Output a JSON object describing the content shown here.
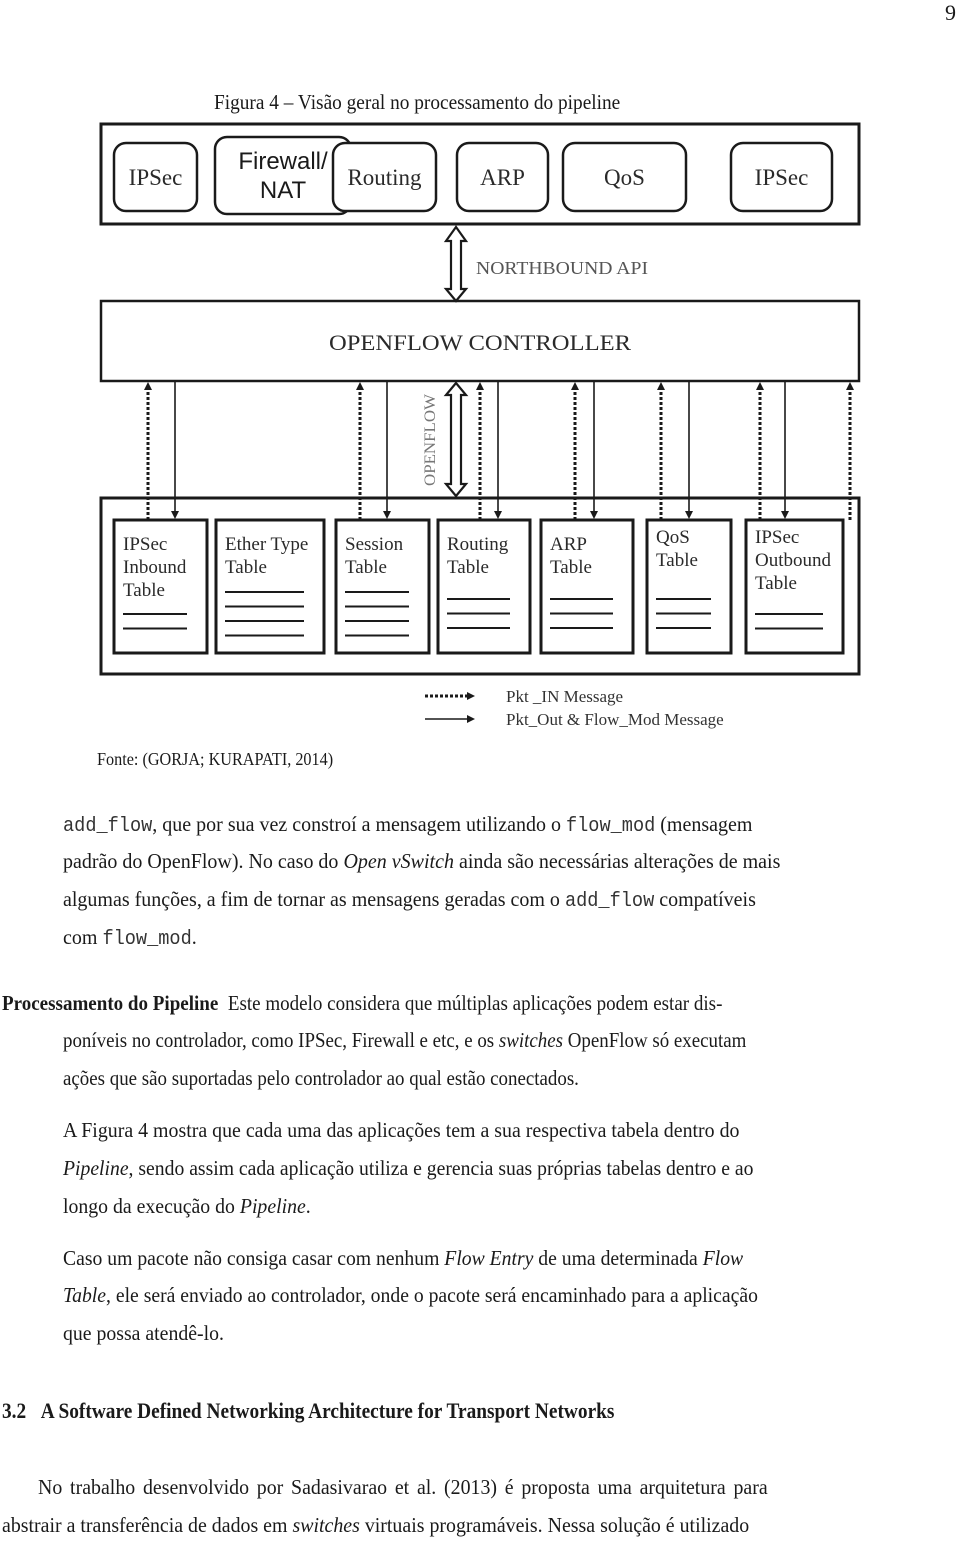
{
  "page": {
    "number": "9"
  },
  "figure": {
    "caption": "Figura 4 – Visão geral no processamento do pipeline",
    "source": "Fonte: (GORJA; KURAPATI, 2014)",
    "applications": [
      "IPSec",
      "Firewall/\nNAT",
      "Routing",
      "ARP",
      "QoS",
      "IPSec"
    ],
    "northbound_label": "NORTHBOUND API",
    "controller_label": "OPENFLOW CONTROLLER",
    "openflow_label": "OPENFLOW",
    "tables": [
      {
        "lines": [
          "IPSec",
          "Inbound",
          "Table"
        ],
        "entries": 2
      },
      {
        "lines": [
          "Ether Type",
          "Table"
        ],
        "entries": 4
      },
      {
        "lines": [
          "Session",
          "Table"
        ],
        "entries": 4
      },
      {
        "lines": [
          "Routing",
          "Table"
        ],
        "entries": 3
      },
      {
        "lines": [
          "ARP",
          "Table"
        ],
        "entries": 3
      },
      {
        "lines": [
          "QoS",
          "Table"
        ],
        "entries": 3
      },
      {
        "lines": [
          "IPSec",
          "Outbound",
          "Table"
        ],
        "entries": 2
      }
    ],
    "legend": [
      {
        "style": "dotted",
        "label": "Pkt _IN Message"
      },
      {
        "style": "solid",
        "label": "Pkt_Out & Flow_Mod Message"
      }
    ]
  },
  "body": {
    "p1": {
      "l1": {
        "c1": "add_flow",
        "t1": ", que por sua vez constroí a mensagem utilizando o ",
        "c2": "flow_mod",
        "t2": " (mensagem"
      },
      "l2": {
        "t1": "padrão do OpenFlow). No caso do ",
        "i1": "Open vSwitch",
        "t2": " ainda são necessárias alterações de mais"
      },
      "l3": {
        "t1": "algumas funções, a fim de tornar as mensagens geradas com o ",
        "c1": "add_flow",
        "t2": " compatíveis"
      },
      "l4": {
        "t1": "com ",
        "c1": "flow_mod",
        "t2": "."
      }
    },
    "p2": {
      "heading": "Processamento do Pipeline",
      "l1": "Este modelo considera que múltiplas aplicações podem estar dis-",
      "l2": {
        "t1": "poníveis no controlador, como IPSec, Firewall e etc, e os ",
        "i1": "switches",
        "t2": " OpenFlow só executam"
      },
      "l3": "ações que são suportadas pelo controlador ao qual estão conectados."
    },
    "p3": {
      "l1": "A Figura 4 mostra que cada uma das aplicações tem a sua respectiva tabela dentro do",
      "l2": {
        "i1": "Pipeline",
        "t1": ", sendo assim cada aplicação utiliza e gerencia suas próprias tabelas dentro e ao"
      },
      "l3": {
        "t1": "longo da execução do ",
        "i1": "Pipeline",
        "t2": "."
      }
    },
    "p4": {
      "l1": {
        "t1": "Caso um pacote não consiga casar com nenhum ",
        "i1": "Flow Entry",
        "t2": " de uma determinada ",
        "i2": "Flow"
      },
      "l2": {
        "i1": "Table",
        "t1": ", ele será enviado ao controlador, onde o pacote será encaminhado para a aplicação"
      },
      "l3": "que possa atendê-lo."
    },
    "section": {
      "number": "3.2",
      "title": "A Software Defined Networking Architecture for Transport Networks"
    },
    "p5": {
      "l1": "No trabalho desenvolvido por Sadasivarao et al. (2013) é proposta uma arquitetura para",
      "l2": {
        "t1": "abstrair a transferência de dados em ",
        "i1": "switches",
        "t2": " virtuais programáveis. Nessa solução é utilizado"
      }
    }
  }
}
